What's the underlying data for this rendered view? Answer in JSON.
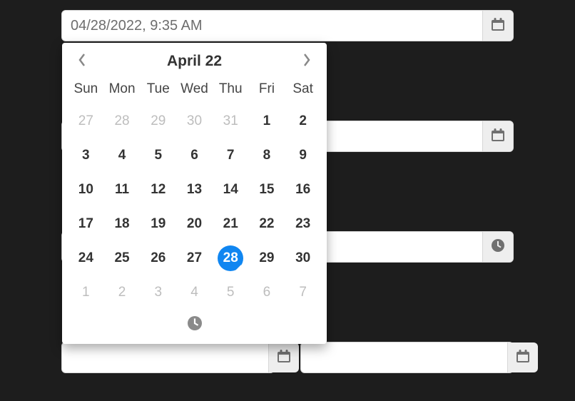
{
  "fields": {
    "f1": {
      "value": "04/28/2022, 9:35 AM",
      "icon": "calendar"
    },
    "f2": {
      "value": "",
      "icon": "calendar"
    },
    "f3": {
      "value": "",
      "icon": "clock"
    },
    "f4": {
      "value": "",
      "icon": "calendar"
    },
    "f5": {
      "value": "",
      "icon": "calendar"
    }
  },
  "picker": {
    "title": "April 22",
    "dow": [
      "Sun",
      "Mon",
      "Tue",
      "Wed",
      "Thu",
      "Fri",
      "Sat"
    ],
    "cells": [
      {
        "n": 27,
        "other": true
      },
      {
        "n": 28,
        "other": true
      },
      {
        "n": 29,
        "other": true
      },
      {
        "n": 30,
        "other": true
      },
      {
        "n": 31,
        "other": true
      },
      {
        "n": 1
      },
      {
        "n": 2
      },
      {
        "n": 3
      },
      {
        "n": 4
      },
      {
        "n": 5
      },
      {
        "n": 6
      },
      {
        "n": 7
      },
      {
        "n": 8
      },
      {
        "n": 9
      },
      {
        "n": 10
      },
      {
        "n": 11
      },
      {
        "n": 12
      },
      {
        "n": 13
      },
      {
        "n": 14
      },
      {
        "n": 15
      },
      {
        "n": 16
      },
      {
        "n": 17
      },
      {
        "n": 18
      },
      {
        "n": 19
      },
      {
        "n": 20
      },
      {
        "n": 21
      },
      {
        "n": 22
      },
      {
        "n": 23
      },
      {
        "n": 24
      },
      {
        "n": 25
      },
      {
        "n": 26
      },
      {
        "n": 27
      },
      {
        "n": 28,
        "selected": true
      },
      {
        "n": 29
      },
      {
        "n": 30
      },
      {
        "n": 1,
        "other": true
      },
      {
        "n": 2,
        "other": true
      },
      {
        "n": 3,
        "other": true
      },
      {
        "n": 4,
        "other": true
      },
      {
        "n": 5,
        "other": true
      },
      {
        "n": 6,
        "other": true
      },
      {
        "n": 7,
        "other": true
      }
    ]
  }
}
